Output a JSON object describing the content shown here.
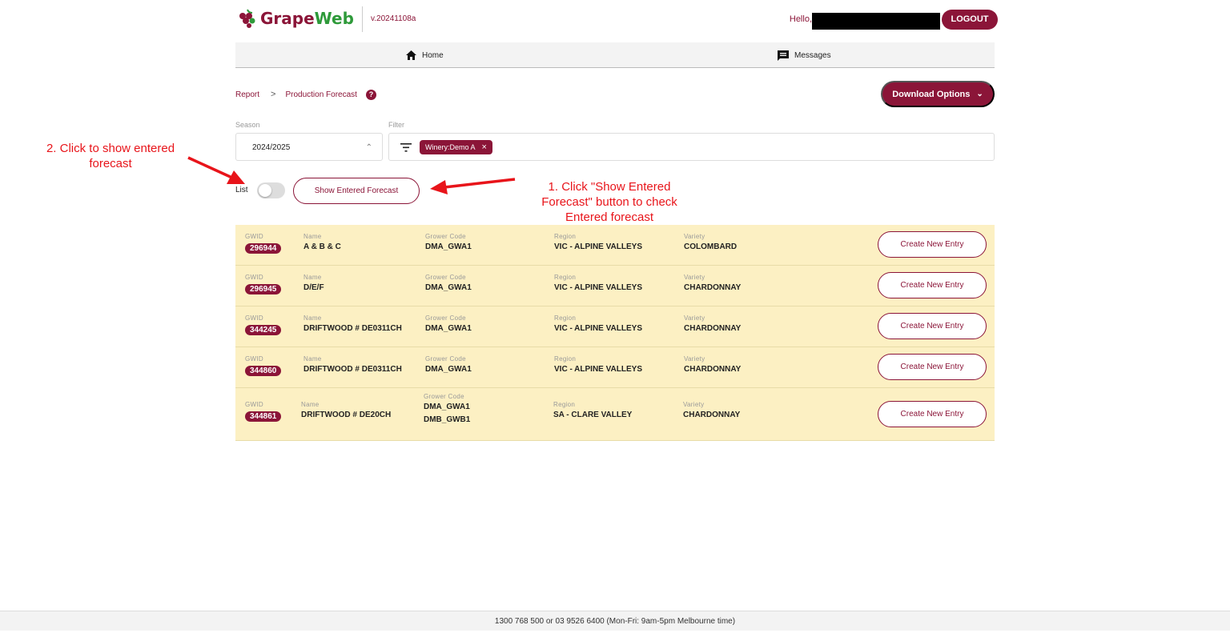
{
  "header": {
    "logo_prefix": "Grape",
    "logo_suffix": "Web",
    "version": "v.20241108a",
    "hello": "Hello,",
    "logout_label": "LOGOUT"
  },
  "nav": {
    "home_label": "Home",
    "messages_label": "Messages"
  },
  "breadcrumb": {
    "report": "Report",
    "separator": ">",
    "current": "Production Forecast",
    "help": "?"
  },
  "download_label": "Download Options",
  "filters": {
    "season_label": "Season",
    "season_value": "2024/2025",
    "filter_label": "Filter",
    "chip": "Winery:Demo A"
  },
  "list_label": "List",
  "show_entered_label": "Show Entered Forecast",
  "columns": {
    "gwid": "GWID",
    "name": "Name",
    "grower_code": "Grower Code",
    "region": "Region",
    "variety": "Variety"
  },
  "rows": [
    {
      "gwid": "296944",
      "name": "A & B & C",
      "grower_code": "DMA_GWA1",
      "grower_code2": "",
      "region": "VIC - ALPINE VALLEYS",
      "variety": "COLOMBARD",
      "action": "Create New Entry"
    },
    {
      "gwid": "296945",
      "name": "D/E/F",
      "grower_code": "DMA_GWA1",
      "grower_code2": "",
      "region": "VIC - ALPINE VALLEYS",
      "variety": "CHARDONNAY",
      "action": "Create New Entry"
    },
    {
      "gwid": "344245",
      "name": "DRIFTWOOD # DE0311CH",
      "grower_code": "DMA_GWA1",
      "grower_code2": "",
      "region": "VIC - ALPINE VALLEYS",
      "variety": "CHARDONNAY",
      "action": "Create New Entry"
    },
    {
      "gwid": "344860",
      "name": "DRIFTWOOD # DE0311CH",
      "grower_code": "DMA_GWA1",
      "grower_code2": "",
      "region": "VIC - ALPINE VALLEYS",
      "variety": "CHARDONNAY",
      "action": "Create New Entry"
    },
    {
      "gwid": "344861",
      "name": "DRIFTWOOD # DE20CH",
      "grower_code": "DMA_GWA1",
      "grower_code2": "DMB_GWB1",
      "region": "SA - CLARE VALLEY",
      "variety": "CHARDONNAY",
      "action": "Create New Entry"
    }
  ],
  "annotations": {
    "step2_line1": "2. Click to show entered",
    "step2_line2": "forecast",
    "step1_line1": "1. Click \"Show Entered",
    "step1_line2": "Forecast\" button to check",
    "step1_line3": "Entered forecast",
    "color": "#e8141a"
  },
  "footer": "1300 768 500 or 03 9526 6400 (Mon-Fri: 9am-5pm Melbourne time)",
  "colors": {
    "brand": "#8b1538",
    "brand_green": "#2e9a3a",
    "row_bg": "#fcf0c3"
  }
}
